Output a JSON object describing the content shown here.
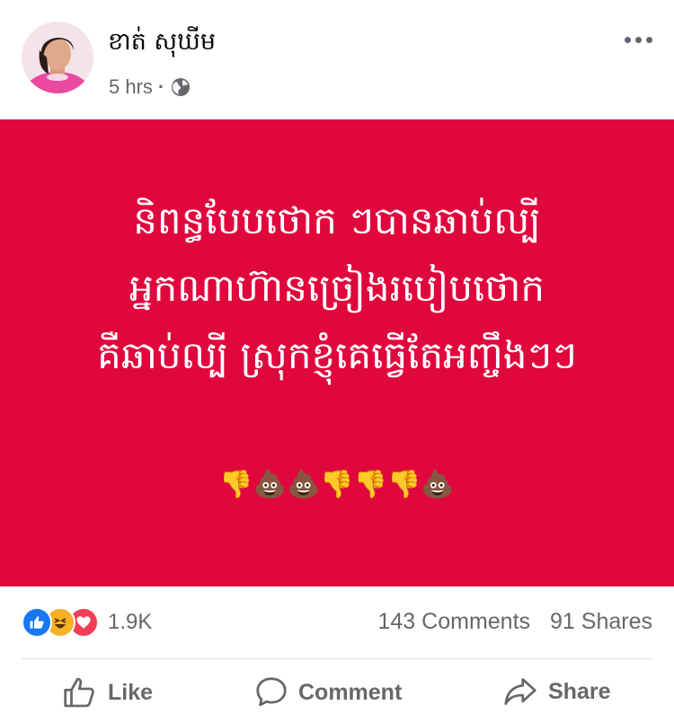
{
  "post": {
    "author": "ខាត់ សុឃីម",
    "time": "5 hrs",
    "separator": "·",
    "privacy_icon": "globe-icon",
    "lines": [
      "និពន្ធបែបថោក ៗបានឆាប់ល្បី",
      "អ្នកណាហ៊ានច្រៀងរបៀបថោក",
      "គឺឆាប់ល្បី ស្រុកខ្ញុំគេធ្វើតែអញ្ចឹងៗៗ"
    ],
    "emojis": "👎💩💩👎👎👎💩",
    "background_color": "#e0073d"
  },
  "reactions": {
    "count": "1.9K",
    "types": [
      "like",
      "haha",
      "love"
    ]
  },
  "stats": {
    "comments": "143 Comments",
    "shares": "91 Shares"
  },
  "actions": {
    "like": "Like",
    "comment": "Comment",
    "share": "Share"
  }
}
